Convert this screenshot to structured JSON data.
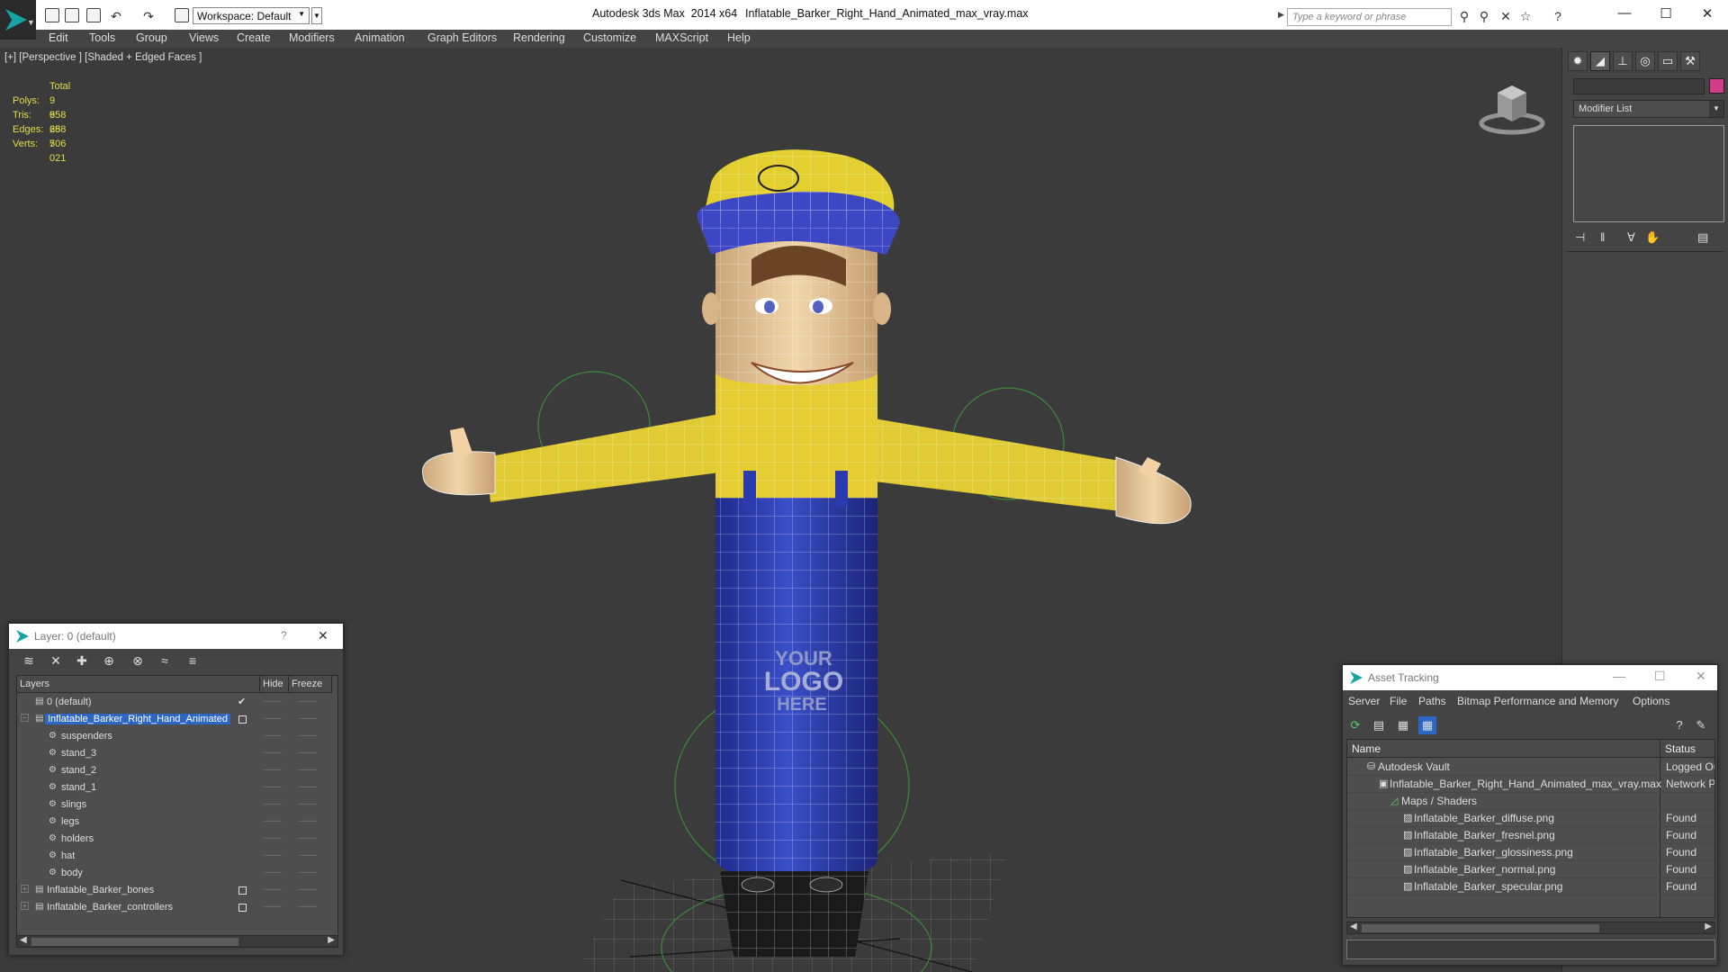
{
  "app": {
    "title": "Autodesk 3ds Max  2014 x64",
    "file": "Inflatable_Barker_Right_Hand_Animated_max_vray.max",
    "workspace": "Workspace: Default",
    "search_placeholder": "Type a keyword or phrase"
  },
  "menu": [
    "Edit",
    "Tools",
    "Group",
    "Views",
    "Create",
    "Modifiers",
    "Animation",
    "Graph Editors",
    "Rendering",
    "Customize",
    "MAXScript",
    "Help"
  ],
  "viewport": {
    "label": "[+] [Perspective ] [Shaded + Edged Faces ]",
    "stats": {
      "header": "Total",
      "rows": [
        {
          "k": "Polys:",
          "v": "9 658"
        },
        {
          "k": "Tris:",
          "v": "9 658"
        },
        {
          "k": "Edges:",
          "v": "28 706"
        },
        {
          "k": "Verts:",
          "v": "5 021"
        }
      ]
    },
    "logo_text": [
      "YOUR",
      "LOGO",
      "HERE"
    ]
  },
  "command_panel": {
    "modifier_list": "Modifier List",
    "object_color": "#d23b89"
  },
  "layers": {
    "title": "Layer: 0 (default)",
    "help": "?",
    "columns": {
      "name": "Layers",
      "hide": "Hide",
      "freeze": "Freeze"
    },
    "rows": [
      {
        "name": "0 (default)"
      },
      {
        "name": "Inflatable_Barker_Right_Hand_Animated"
      },
      {
        "name": "suspenders"
      },
      {
        "name": "stand_3"
      },
      {
        "name": "stand_2"
      },
      {
        "name": "stand_1"
      },
      {
        "name": "slings"
      },
      {
        "name": "legs"
      },
      {
        "name": "holders"
      },
      {
        "name": "hat"
      },
      {
        "name": "body"
      },
      {
        "name": "Inflatable_Barker_bones"
      },
      {
        "name": "Inflatable_Barker_controllers"
      }
    ]
  },
  "asset_tracking": {
    "title": "Asset Tracking",
    "menu": [
      "Server",
      "File",
      "Paths",
      "Bitmap Performance and Memory",
      "Options"
    ],
    "columns": {
      "name": "Name",
      "status": "Status"
    },
    "rows": [
      {
        "name": "Autodesk Vault",
        "status": "Logged Out"
      },
      {
        "name": "Inflatable_Barker_Right_Hand_Animated_max_vray.max",
        "status": "Network Path"
      },
      {
        "name": "Maps / Shaders",
        "status": ""
      },
      {
        "name": "Inflatable_Barker_diffuse.png",
        "status": "Found"
      },
      {
        "name": "Inflatable_Barker_fresnel.png",
        "status": "Found"
      },
      {
        "name": "Inflatable_Barker_glossiness.png",
        "status": "Found"
      },
      {
        "name": "Inflatable_Barker_normal.png",
        "status": "Found"
      },
      {
        "name": "Inflatable_Barker_specular.png",
        "status": "Found"
      }
    ]
  }
}
